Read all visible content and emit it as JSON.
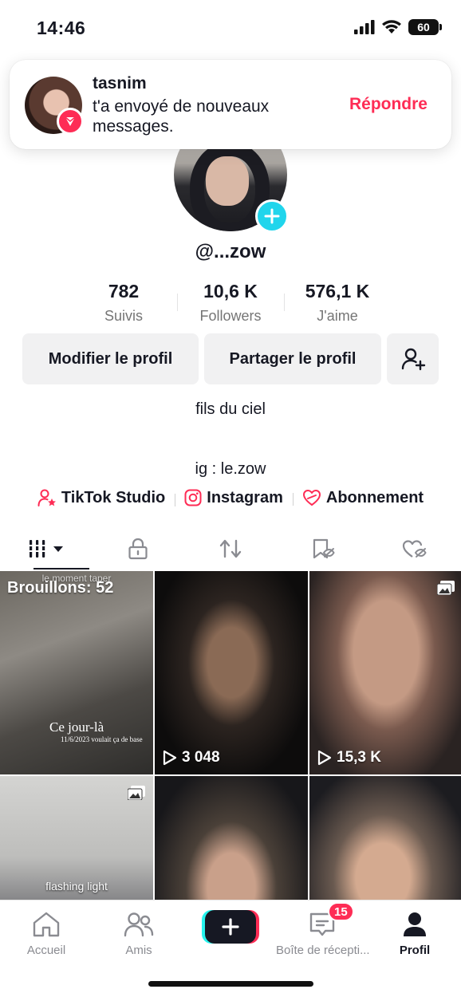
{
  "status_bar": {
    "time": "14:46",
    "battery": "60"
  },
  "notification": {
    "sender": "tasnim",
    "message": "t'a envoyé de nouveaux messages.",
    "action": "Répondre"
  },
  "profile": {
    "username": "@...zow",
    "stats": [
      {
        "value": "782",
        "label": "Suivis"
      },
      {
        "value": "10,6 K",
        "label": "Followers"
      },
      {
        "value": "576,1 K",
        "label": "J'aime"
      }
    ],
    "buttons": {
      "edit": "Modifier le profil",
      "share": "Partager le profil"
    },
    "bio_line1": "fils du ciel",
    "bio_line2": "ig : le.zow",
    "links": [
      {
        "label": "TikTok Studio",
        "icon": "person-star-icon"
      },
      {
        "label": "Instagram",
        "icon": "instagram-icon"
      },
      {
        "label": "Abonnement",
        "icon": "subscription-heart-icon"
      }
    ]
  },
  "tabs": [
    "videos-grid-icon",
    "lock-icon",
    "repost-icon",
    "saved-icon",
    "liked-icon"
  ],
  "grid": [
    {
      "type": "drafts",
      "label": "Brouillons: 52",
      "top_caption": "le moment taper",
      "overlay_title": "Ce jour-là",
      "overlay_sub": "11/6/2023 voulait ça de base"
    },
    {
      "type": "video",
      "views": "3 048"
    },
    {
      "type": "photo",
      "views": "15,3 K"
    },
    {
      "type": "photo",
      "caption": "flashing light"
    },
    {
      "type": "video"
    },
    {
      "type": "video"
    }
  ],
  "bottom_nav": {
    "home": "Accueil",
    "friends": "Amis",
    "inbox": "Boîte de récepti...",
    "inbox_badge": "15",
    "profile": "Profil"
  },
  "colors": {
    "accent": "#fe2c55",
    "cyan": "#25f4ee",
    "avatar_add": "#20d5ec"
  }
}
